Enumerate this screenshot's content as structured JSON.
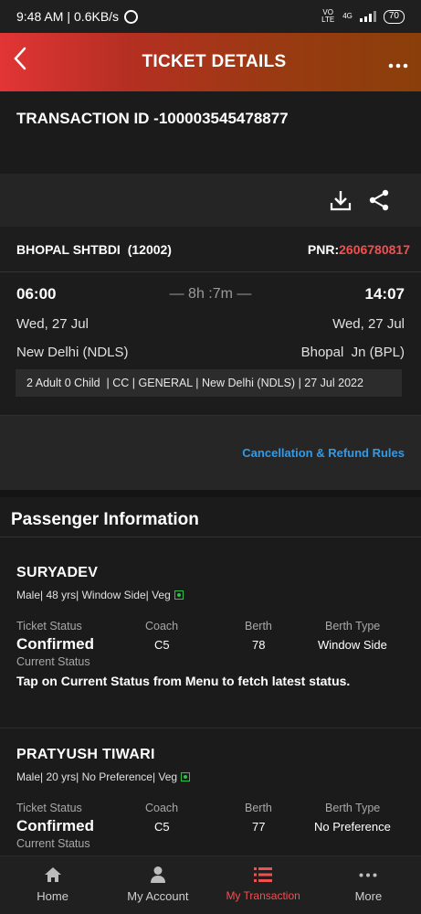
{
  "status_bar": {
    "time": "9:48 AM",
    "speed": "0.6KB/s",
    "network_1": "VO LTE",
    "network_2": "4G",
    "battery": "70"
  },
  "app_bar": {
    "title": "TICKET DETAILS",
    "back_icon": "chevron-left-icon",
    "menu_icon": "more-dots-icon"
  },
  "transaction": {
    "label": "TRANSACTION ID -100003545478877"
  },
  "actions": {
    "download_icon": "download-icon",
    "share_icon": "share-icon"
  },
  "train": {
    "name": "BHOPAL SHTBDI",
    "number": "(12002)",
    "pnr_label": "PNR:",
    "pnr_value": "2606780817"
  },
  "journey": {
    "departure_time": "06:00",
    "arrival_time": "14:07",
    "duration": "— 8h :7m —",
    "departure_date": "Wed, 27 Jul",
    "arrival_date": "Wed, 27 Jul",
    "from_station": "New Delhi (NDLS)",
    "to_station": "Bhopal  Jn (BPL)",
    "summary": "2 Adult 0 Child  | CC | GENERAL | New Delhi (NDLS) | 27 Jul 2022"
  },
  "rules": {
    "link": "Cancellation & Refund Rules"
  },
  "passenger_section": {
    "title": "Passenger Information"
  },
  "labels": {
    "ticket_status": "Ticket Status",
    "coach": "Coach",
    "berth": "Berth",
    "berth_type": "Berth Type",
    "current_status": "Current Status"
  },
  "passengers": [
    {
      "name": "SURYADEV",
      "meta": "Male| 48 yrs| Window Side| Veg",
      "ticket_status": "Confirmed",
      "coach": "C5",
      "berth": "78",
      "berth_type": "Window Side",
      "current_status": "Tap on Current Status from Menu to fetch latest status."
    },
    {
      "name": "PRATYUSH TIWARI",
      "meta": "Male| 20 yrs| No Preference| Veg",
      "ticket_status": "Confirmed",
      "coach": "C5",
      "berth": "77",
      "berth_type": "No Preference"
    }
  ],
  "bottom_nav": [
    {
      "label": "Home",
      "icon": "home-icon"
    },
    {
      "label": "My Account",
      "icon": "user-icon"
    },
    {
      "label": "My Transaction",
      "icon": "list-icon"
    },
    {
      "label": "More",
      "icon": "more-dots-icon"
    }
  ],
  "colors": {
    "accent": "#f25050",
    "link": "#2f9bea",
    "veg": "#2ec24a"
  }
}
